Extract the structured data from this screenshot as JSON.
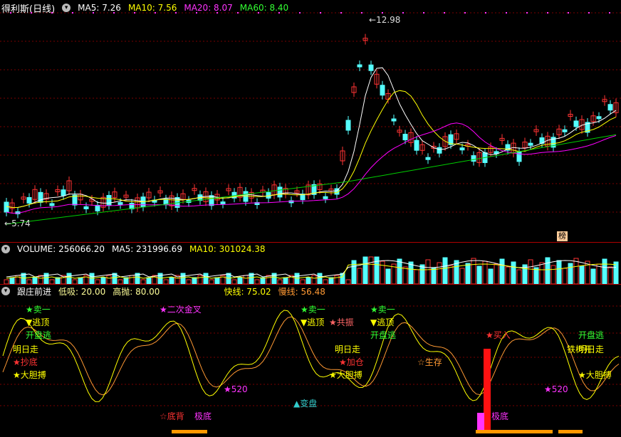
{
  "main": {
    "title": "得利斯(日线)",
    "ma5_label": "MA5: 7.26",
    "ma10_label": "MA10: 7.56",
    "ma20_label": "MA20: 8.07",
    "ma60_label": "MA60: 8.40",
    "high_marker": "12.98",
    "low_marker": "5.74",
    "rank_badge": "榜",
    "colors": {
      "ma5": "#ffffff",
      "ma10": "#ffff00",
      "ma20": "#ff00ff",
      "ma60": "#00cc00",
      "up": "#ff3333",
      "down": "#55ffff"
    }
  },
  "volume": {
    "title": "VOLUME: 256066.20",
    "ma5_label": "MA5: 231996.69",
    "ma10_label": "MA10: 301024.38"
  },
  "indicator": {
    "title": "跟庄前进",
    "low_label": "低吸: 20.00",
    "high_label": "高抛: 80.00",
    "fast_label": "快线: 75.02",
    "slow_label": "慢线: 56.48",
    "signals": [
      {
        "text": "★卖一",
        "color": "#33ff33"
      },
      {
        "text": "▼逃顶",
        "color": "#ffff00"
      },
      {
        "text": "开盘逃",
        "color": "#33ff33"
      },
      {
        "text": "明日走",
        "color": "#ffff00"
      },
      {
        "text": "★抄底",
        "color": "#ff3333"
      },
      {
        "text": "★大胆搏",
        "color": "#ffff00"
      },
      {
        "text": "★二次金叉",
        "color": "#ff33ff"
      },
      {
        "text": "★520",
        "color": "#ff33ff"
      },
      {
        "text": "☆底背",
        "color": "#ff3333"
      },
      {
        "text": "极底",
        "color": "#ff33ff"
      },
      {
        "text": "★卖一",
        "color": "#33ff33"
      },
      {
        "text": "▼逃顶",
        "color": "#ffff00"
      },
      {
        "text": "★共振",
        "color": "#ff6666"
      },
      {
        "text": "明日走",
        "color": "#ffff00"
      },
      {
        "text": "★加仓",
        "color": "#ff3333"
      },
      {
        "text": "★大胆搏",
        "color": "#ffff00"
      },
      {
        "text": "▲变盘",
        "color": "#33cccc"
      },
      {
        "text": "★卖一",
        "color": "#33ff33"
      },
      {
        "text": "▼逃顶",
        "color": "#ffff00"
      },
      {
        "text": "开盘逃",
        "color": "#33ff33"
      },
      {
        "text": "☆生存",
        "color": "#ff9933"
      },
      {
        "text": "★买入",
        "color": "#ff3333"
      },
      {
        "text": "极底",
        "color": "#ff33ff"
      },
      {
        "text": "★520",
        "color": "#ff33ff"
      },
      {
        "text": "铁树开",
        "color": "#ffff00"
      },
      {
        "text": "明日走",
        "color": "#ffff00"
      },
      {
        "text": "开盘逃",
        "color": "#33ff33"
      },
      {
        "text": "★大胆搏",
        "color": "#ffff00"
      }
    ]
  }
}
